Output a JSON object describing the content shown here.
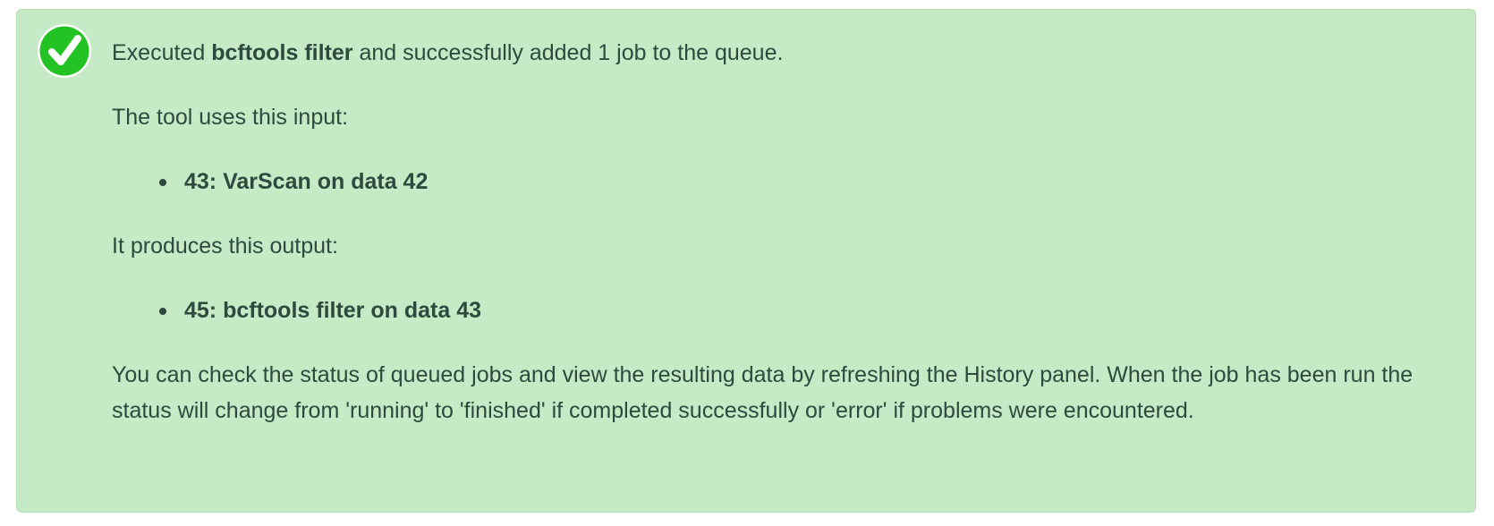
{
  "alert": {
    "status": "success",
    "icon": "check-circle-icon",
    "colors": {
      "background": "#c5eac5",
      "icon_fill": "#22c322",
      "text": "#2c4a3e"
    },
    "intro_prefix": "Executed ",
    "tool_name": "bcftools filter",
    "intro_suffix": " and successfully added 1 job to the queue.",
    "inputs_heading": "The tool uses this input:",
    "inputs": [
      "43: VarScan on data 42"
    ],
    "outputs_heading": "It produces this output:",
    "outputs": [
      "45: bcftools filter on data 43"
    ],
    "footer": "You can check the status of queued jobs and view the resulting data by refreshing the History panel. When the job has been run the status will change from 'running' to 'finished' if completed successfully or 'error' if problems were encountered."
  }
}
